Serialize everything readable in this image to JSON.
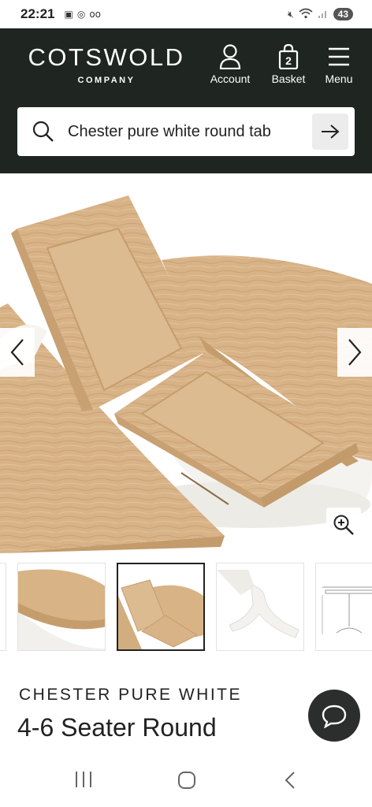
{
  "status_bar": {
    "time": "22:21",
    "battery": "43"
  },
  "header": {
    "logo_main": "COTSWOLD",
    "logo_sub": "COMPANY",
    "account_label": "Account",
    "basket_label": "Basket",
    "basket_count": "2",
    "menu_label": "Menu",
    "background_color": "#1f2520"
  },
  "search": {
    "value": "Chester pure white round tab"
  },
  "product": {
    "brand_line": "CHESTER PURE WHITE",
    "title_line": "4-6 Seater Round"
  },
  "icons": [
    "search-icon",
    "account-icon",
    "basket-icon",
    "menu-icon",
    "arrow-right-icon",
    "chevron-left-icon",
    "chevron-right-icon",
    "zoom-in-icon",
    "chat-icon"
  ],
  "colors": {
    "wood": "#d9b58a",
    "chat_button": "#2b2e2c"
  }
}
